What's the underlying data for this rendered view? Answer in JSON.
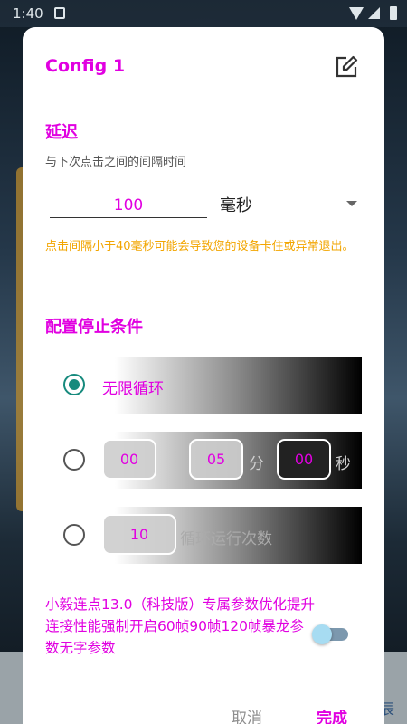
{
  "status_bar": {
    "time": "1:40"
  },
  "background": {
    "corner_label": "辰"
  },
  "dialog": {
    "title": "Config 1",
    "delay": {
      "title": "延迟",
      "description": "与下次点击之间的间隔时间",
      "value": "100",
      "unit": "毫秒",
      "warning": "点击间隔小于40毫秒可能会导致您的设备卡住或异常退出。"
    },
    "stop": {
      "title": "配置停止条件",
      "infinite_label": "无限循环",
      "timer": {
        "hours": "00",
        "minutes": "05",
        "minutes_unit": "分",
        "seconds": "00",
        "seconds_unit": "秒"
      },
      "count": {
        "value": "10",
        "label": "循环运行次数"
      }
    },
    "promo_text": "小毅连点13.0（科技版）专属参数优化提升连接性能强制开启60帧90帧120帧暴龙参数无字参数",
    "buttons": {
      "cancel": "取消",
      "done": "完成"
    },
    "colors": {
      "accent": "#e100e1",
      "warning": "#f2a500",
      "radio": "#168a7d"
    }
  }
}
